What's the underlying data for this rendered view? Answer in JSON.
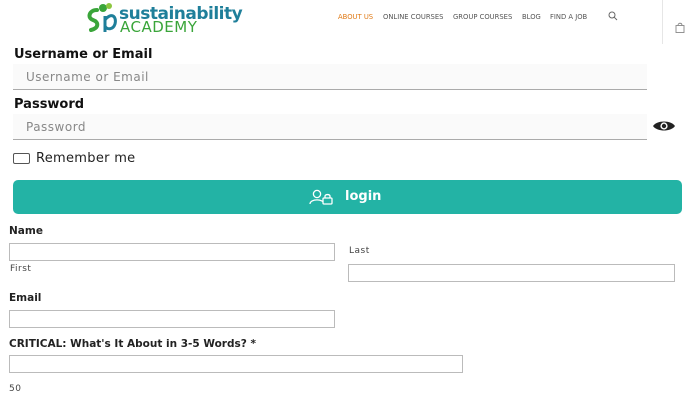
{
  "header": {
    "logo": {
      "top": "sustainability",
      "bottom": "ACADEMY"
    },
    "nav": [
      {
        "label": "ABOUT US",
        "active": true
      },
      {
        "label": "ONLINE COURSES",
        "active": false
      },
      {
        "label": "GROUP COURSES",
        "active": false
      },
      {
        "label": "BLOG",
        "active": false
      },
      {
        "label": "FIND A JOB",
        "active": false
      }
    ],
    "icons": {
      "search": "search-icon",
      "cart": "shopping-bag-icon"
    }
  },
  "login": {
    "username_label": "Username or Email",
    "username_placeholder": "Username or Email",
    "password_label": "Password",
    "password_placeholder": "Password",
    "remember_label": "Remember me",
    "remember_checked": false,
    "button_label": "login",
    "button_icon": "user-lock-icon",
    "eye_icon": "eye-icon"
  },
  "form": {
    "name_label": "Name",
    "first_label": "First",
    "last_label": "Last",
    "email_label": "Email",
    "about_label": "CRITICAL: What's It About in 3-5 Words? *",
    "char_count": "50"
  },
  "colors": {
    "accent": "#23b3a5",
    "nav_active": "#e07b18",
    "logo_blue": "#1f7f9a",
    "logo_green": "#3aa53a"
  }
}
